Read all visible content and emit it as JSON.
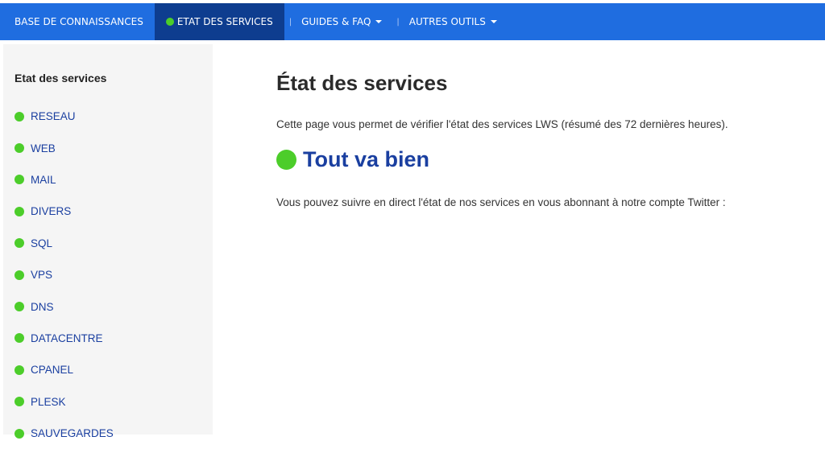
{
  "colors": {
    "nav_bg": "#1f6de0",
    "nav_active_bg": "#0e3d8f",
    "status_ok": "#4ccd2a",
    "link": "#1a3fa0",
    "sidebar_bg": "#f5f5f5"
  },
  "topnav": {
    "items": [
      {
        "label": "BASE DE CONNAISSANCES"
      },
      {
        "label": "ETAT DES SERVICES",
        "status_icon": "green-dot-icon"
      },
      {
        "label": "GUIDES & FAQ",
        "separator": "|",
        "dropdown_icon": "caret-down-icon"
      },
      {
        "label": "AUTRES OUTILS",
        "separator": "|",
        "dropdown_icon": "caret-down-icon"
      }
    ]
  },
  "sidebar": {
    "title": "Etat des services",
    "items": [
      {
        "label": "RESEAU",
        "status_icon": "green-dot-icon"
      },
      {
        "label": "WEB",
        "status_icon": "green-dot-icon"
      },
      {
        "label": "MAIL",
        "status_icon": "green-dot-icon"
      },
      {
        "label": "DIVERS",
        "status_icon": "green-dot-icon"
      },
      {
        "label": "SQL",
        "status_icon": "green-dot-icon"
      },
      {
        "label": "VPS",
        "status_icon": "green-dot-icon"
      },
      {
        "label": "DNS",
        "status_icon": "green-dot-icon"
      },
      {
        "label": "DATACENTRE",
        "status_icon": "green-dot-icon"
      },
      {
        "label": "CPANEL",
        "status_icon": "green-dot-icon"
      },
      {
        "label": "PLESK",
        "status_icon": "green-dot-icon"
      },
      {
        "label": "SAUVEGARDES",
        "status_icon": "green-dot-icon"
      }
    ]
  },
  "main": {
    "title": "État des services",
    "intro": "Cette page vous permet de vérifier l'état des services LWS (résumé des 72 dernières heures).",
    "status_text": "Tout va bien",
    "follow_text": "Vous pouvez suivre en direct l'état de nos services en vous abonnant à notre compte Twitter :"
  }
}
